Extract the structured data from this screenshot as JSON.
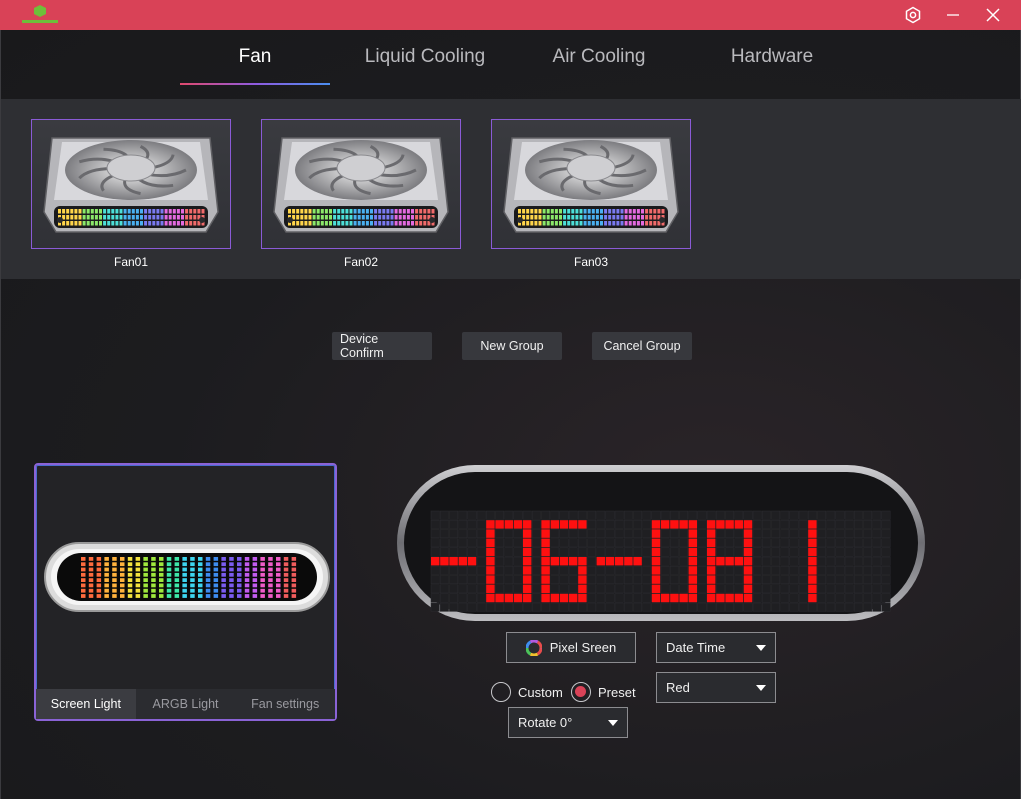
{
  "titlebar": {
    "logo_icon": "hexagon-brand-logo",
    "settings_icon": "hexagon-gear-icon",
    "minimize_icon": "minimize-icon",
    "close_icon": "close-icon",
    "bar_color": "#d94257"
  },
  "tabs": [
    {
      "label": "Fan",
      "active": true
    },
    {
      "label": "Liquid Cooling",
      "active": false
    },
    {
      "label": "Air Cooling",
      "active": false
    },
    {
      "label": "Hardware",
      "active": false
    }
  ],
  "fans": [
    {
      "label": "Fan01"
    },
    {
      "label": "Fan02"
    },
    {
      "label": "Fan03"
    }
  ],
  "actions": {
    "device_confirm": "Device Confirm",
    "new_group": "New Group",
    "cancel_group": "Cancel Group"
  },
  "preview": {
    "tabs": [
      {
        "label": "Screen Light",
        "active": true
      },
      {
        "label": "ARGB Light",
        "active": false
      },
      {
        "label": "Fan settings",
        "active": false
      }
    ]
  },
  "display": {
    "text": "-06-08 1",
    "led_color": "#ff1010"
  },
  "controls": {
    "pixel_screen_label": "Pixel Sreen",
    "pixel_screen_icon": "color-wheel-icon",
    "mode_select": "Date Time",
    "color_select": "Red",
    "rotate_select": "Rotate 0°",
    "custom_label": "Custom",
    "preset_label": "Preset",
    "preset_selected": true
  }
}
